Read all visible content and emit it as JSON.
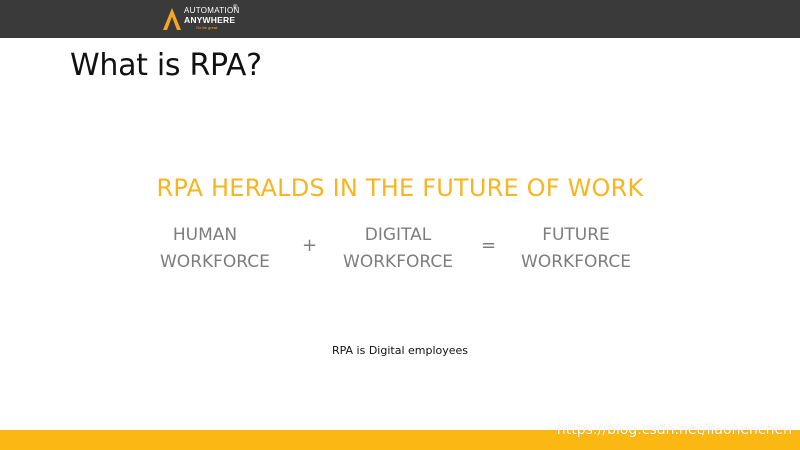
{
  "header": {
    "logo": {
      "line1": "AUTOMATION",
      "line2": "ANYWHERE",
      "tagline": "Go be great.",
      "registered": "®",
      "brand_color": "#f5a623"
    },
    "bar_color": "#3a3a3a"
  },
  "slide": {
    "title": "What is RPA?",
    "headline": "RPA HERALDS IN THE FUTURE OF WORK",
    "headline_color": "#f7b520",
    "equation": {
      "term1": {
        "line1": "HUMAN",
        "line2": "WORKFORCE"
      },
      "plus": "+",
      "term2": {
        "line1": "DIGITAL",
        "line2": "WORKFORCE"
      },
      "equals": "=",
      "term3": {
        "line1": "FUTURE",
        "line2": "WORKFORCE"
      }
    },
    "caption": "RPA is Digital employees"
  },
  "footer": {
    "bar_color": "#fbb812",
    "watermark": "https://blog.csdn.net/liaohenchen"
  }
}
